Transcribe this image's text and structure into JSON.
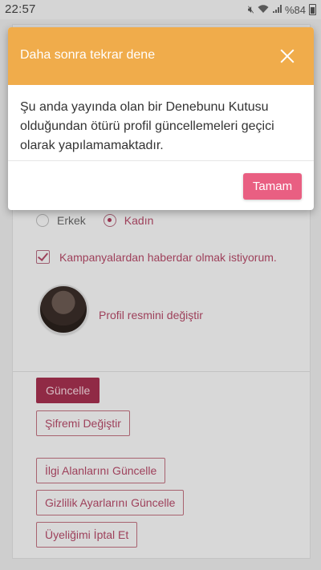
{
  "status_bar": {
    "time": "22:57",
    "battery": "%84"
  },
  "form": {
    "gender": {
      "options": [
        "Erkek",
        "Kadın"
      ],
      "selected": "Kadın"
    },
    "campaign_label": "Kampanyalardan haberdar olmak istiyorum.",
    "campaign_checked": true,
    "avatar_link": "Profil resmini değiştir",
    "buttons": {
      "update": "Güncelle",
      "change_password": "Şifremi Değiştir",
      "update_interests": "İlgi Alanlarını Güncelle",
      "update_privacy": "Gizlilik Ayarlarını Güncelle",
      "cancel_membership": "Üyeliğimi İptal Et"
    }
  },
  "modal": {
    "title": "Daha sonra tekrar dene",
    "message": "Şu anda yayında olan bir Denebunu Kutusu olduğundan ötürü profil güncellemeleri geçici olarak yapılamamaktadır.",
    "ok_label": "Tamam"
  }
}
